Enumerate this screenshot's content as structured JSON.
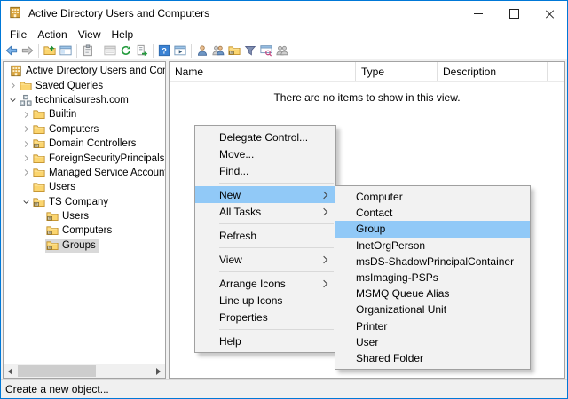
{
  "window": {
    "title": "Active Directory Users and Computers"
  },
  "menubar": {
    "items": [
      "File",
      "Action",
      "View",
      "Help"
    ]
  },
  "toolbar": {
    "items": [
      {
        "icon": "back-icon"
      },
      {
        "icon": "forward-icon"
      },
      {
        "sep": true
      },
      {
        "icon": "up-level-icon"
      },
      {
        "icon": "console-tree-icon"
      },
      {
        "sep": true
      },
      {
        "icon": "clipboard-icon"
      },
      {
        "sep": true
      },
      {
        "icon": "list-window-icon"
      },
      {
        "icon": "refresh-icon"
      },
      {
        "icon": "export-list-icon"
      },
      {
        "sep": true
      },
      {
        "icon": "help-icon"
      },
      {
        "icon": "new-window-icon"
      },
      {
        "sep": true
      },
      {
        "icon": "new-user-icon"
      },
      {
        "icon": "new-group-icon"
      },
      {
        "icon": "new-ou-icon"
      },
      {
        "icon": "filter-icon"
      },
      {
        "icon": "find-icon"
      },
      {
        "icon": "special-group-icon"
      }
    ]
  },
  "tree": {
    "items": [
      {
        "label": "Active Directory Users and Computers",
        "depth": 0,
        "icon": "root-icon",
        "expander": "none",
        "selected": false
      },
      {
        "label": "Saved Queries",
        "depth": 1,
        "icon": "folder-icon",
        "expander": "collapsed",
        "selected": false
      },
      {
        "label": "technicalsuresh.com",
        "depth": 1,
        "icon": "domain-icon",
        "expander": "expanded",
        "selected": false
      },
      {
        "label": "Builtin",
        "depth": 2,
        "icon": "folder-icon",
        "expander": "collapsed",
        "selected": false
      },
      {
        "label": "Computers",
        "depth": 2,
        "icon": "folder-icon",
        "expander": "collapsed",
        "selected": false
      },
      {
        "label": "Domain Controllers",
        "depth": 2,
        "icon": "ou-icon",
        "expander": "collapsed",
        "selected": false
      },
      {
        "label": "ForeignSecurityPrincipals",
        "depth": 2,
        "icon": "folder-icon",
        "expander": "collapsed",
        "selected": false
      },
      {
        "label": "Managed Service Accounts",
        "depth": 2,
        "icon": "folder-icon",
        "expander": "collapsed",
        "selected": false
      },
      {
        "label": "Users",
        "depth": 2,
        "icon": "folder-icon",
        "expander": "none",
        "selected": false
      },
      {
        "label": "TS Company",
        "depth": 2,
        "icon": "ou-icon",
        "expander": "expanded",
        "selected": false
      },
      {
        "label": "Users",
        "depth": 3,
        "icon": "ou-icon",
        "expander": "none",
        "selected": false
      },
      {
        "label": "Computers",
        "depth": 3,
        "icon": "ou-icon",
        "expander": "none",
        "selected": false
      },
      {
        "label": "Groups",
        "depth": 3,
        "icon": "ou-icon",
        "expander": "none",
        "selected": true
      }
    ]
  },
  "list": {
    "columns": [
      "Name",
      "Type",
      "Description"
    ],
    "empty_message": "There are no items to show in this view."
  },
  "context_menu": {
    "items": [
      {
        "label": "Delegate Control...",
        "type": "item"
      },
      {
        "label": "Move...",
        "type": "item"
      },
      {
        "label": "Find...",
        "type": "item"
      },
      {
        "type": "separator"
      },
      {
        "label": "New",
        "type": "item",
        "submenu": true,
        "highlighted": true
      },
      {
        "label": "All Tasks",
        "type": "item",
        "submenu": true
      },
      {
        "type": "separator"
      },
      {
        "label": "Refresh",
        "type": "item"
      },
      {
        "type": "separator"
      },
      {
        "label": "View",
        "type": "item",
        "submenu": true
      },
      {
        "type": "separator"
      },
      {
        "label": "Arrange Icons",
        "type": "item",
        "submenu": true
      },
      {
        "label": "Line up Icons",
        "type": "item"
      },
      {
        "label": "Properties",
        "type": "item"
      },
      {
        "type": "separator"
      },
      {
        "label": "Help",
        "type": "item"
      }
    ]
  },
  "submenu": {
    "items": [
      {
        "label": "Computer",
        "highlighted": false
      },
      {
        "label": "Contact",
        "highlighted": false
      },
      {
        "label": "Group",
        "highlighted": true
      },
      {
        "label": "InetOrgPerson",
        "highlighted": false
      },
      {
        "label": "msDS-ShadowPrincipalContainer",
        "highlighted": false
      },
      {
        "label": "msImaging-PSPs",
        "highlighted": false
      },
      {
        "label": "MSMQ Queue Alias",
        "highlighted": false
      },
      {
        "label": "Organizational Unit",
        "highlighted": false
      },
      {
        "label": "Printer",
        "highlighted": false
      },
      {
        "label": "User",
        "highlighted": false
      },
      {
        "label": "Shared Folder",
        "highlighted": false
      }
    ]
  },
  "statusbar": {
    "text": "Create a new object..."
  },
  "colors": {
    "accent": "#0078d7",
    "menu_highlight": "#91c9f7",
    "inactive_selection": "#d9d9d9"
  }
}
